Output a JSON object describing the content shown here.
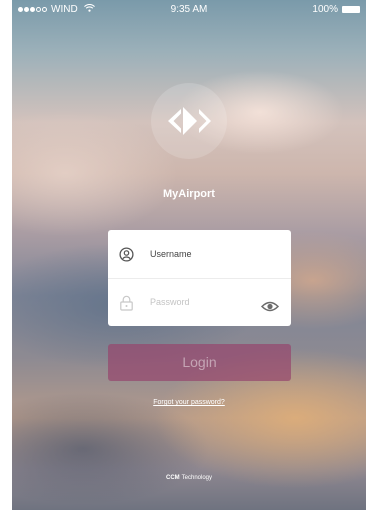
{
  "status_bar": {
    "carrier": "WIND",
    "time": "9:35 AM",
    "battery": "100%",
    "signal_bars_filled": 3,
    "signal_bars_total": 5
  },
  "app": {
    "name": "MyAirport",
    "logo_icon": "diamond-arrow-logo-icon"
  },
  "login_form": {
    "username_placeholder": "Username",
    "password_placeholder": "Password",
    "username_icon": "user-circle-icon",
    "password_icon": "lock-icon",
    "show_password_icon": "eye-icon"
  },
  "actions": {
    "login_label": "Login",
    "forgot_password_label": "Forgot your password?"
  },
  "footer": {
    "brand": "CCM",
    "suffix": "Technology"
  },
  "colors": {
    "login_button": "#96466e",
    "text_on_background": "#ffffff",
    "card_background": "#ffffff"
  }
}
